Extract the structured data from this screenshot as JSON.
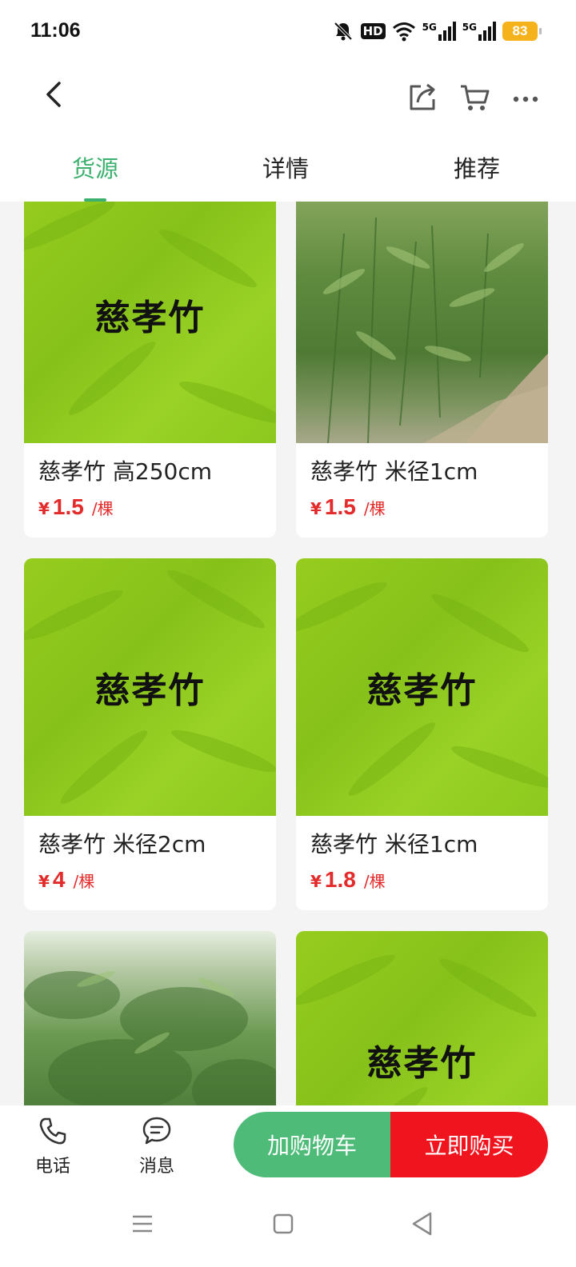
{
  "status_bar": {
    "time": "11:06",
    "hd": "HD",
    "net1": "5G",
    "net2": "5G",
    "battery": "83"
  },
  "tabs": [
    {
      "label": "货源"
    },
    {
      "label": "详情"
    },
    {
      "label": "推荐"
    }
  ],
  "products": [
    {
      "image_text": "慈孝竹",
      "title": "慈孝竹 高250cm",
      "currency": "¥",
      "price": "1.5",
      "unit": "/棵"
    },
    {
      "image_text": "",
      "title": "慈孝竹 米径1cm",
      "currency": "¥",
      "price": "1.5",
      "unit": "/棵"
    },
    {
      "image_text": "慈孝竹",
      "title": "慈孝竹 米径2cm",
      "currency": "¥",
      "price": "4",
      "unit": "/棵"
    },
    {
      "image_text": "慈孝竹",
      "title": "慈孝竹 米径1cm",
      "currency": "¥",
      "price": "1.8",
      "unit": "/棵"
    },
    {
      "image_text": ""
    },
    {
      "image_text": "慈孝竹"
    }
  ],
  "bottom_bar": {
    "phone_label": "电话",
    "message_label": "消息",
    "add_to_cart": "加购物车",
    "buy_now": "立即购买"
  },
  "colors": {
    "accent_green": "#3cb06e",
    "cart_green": "#4fbb79",
    "buy_red": "#f0141f",
    "price_red": "#e32b2b"
  }
}
